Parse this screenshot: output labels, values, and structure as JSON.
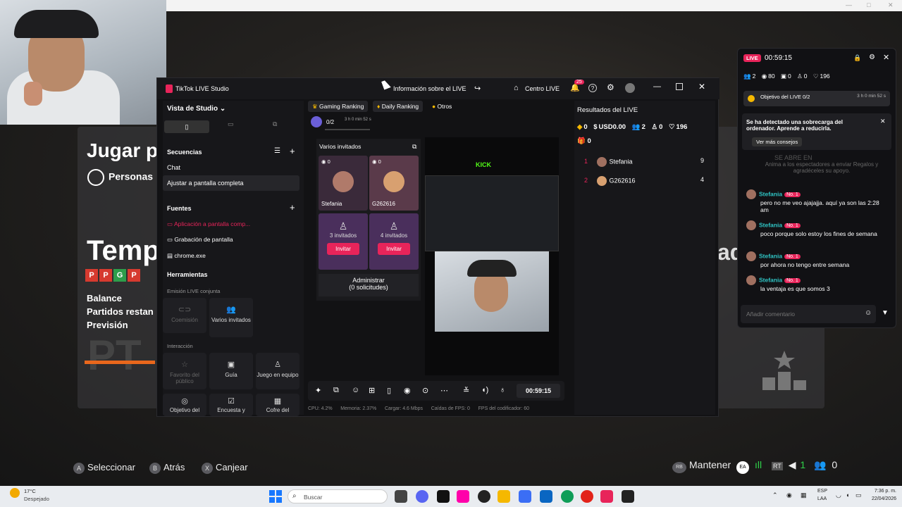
{
  "background": {
    "topstrip_controls": [
      "—",
      "□",
      "✕"
    ],
    "title_jugar": "Jugar p",
    "personas": "Personas",
    "title_temp": "Temp",
    "title_ores": "adores",
    "ppgp": [
      "P",
      "P",
      "G",
      "P"
    ],
    "lines": [
      "Balance",
      "Partidos restan",
      "Previsión"
    ],
    "pt": "PT",
    "hints": [
      {
        "key": "A",
        "label": "Seleccionar"
      },
      {
        "key": "B",
        "label": "Atrás"
      },
      {
        "key": "X",
        "label": "Canjear"
      }
    ],
    "right_hint": {
      "key": "RB",
      "label": "Mantener",
      "counts": [
        "1",
        "0"
      ]
    }
  },
  "studio": {
    "app_title": "TikTok LIVE Studio",
    "info_title": "Información sobre el LIVE",
    "centro": "Centro LIVE",
    "notif_count": "25",
    "view_mode": "Vista de Studio",
    "sequences": "Secuencias",
    "seq_items": [
      "Chat",
      "Ajustar a pantalla completa"
    ],
    "sources": "Fuentes",
    "source_items": [
      "Aplicación a pantalla comp...",
      "Grabación de pantalla",
      "chrome.exe"
    ],
    "tools": "Herramientas",
    "joint": "Emisión LIVE conjunta",
    "joint_tools": [
      "Coemisión",
      "Varios invitados"
    ],
    "interaction": "Interacción",
    "interaction_tools": [
      "Favorito del público",
      "Guía",
      "Juego en equipo"
    ],
    "bottom_tools": [
      "Objetivo del",
      "Encuesta y",
      "Cofre del"
    ],
    "rank_tabs": [
      "Gaming Ranking",
      "Daily Ranking",
      "Otros"
    ],
    "goal": "0/2",
    "goal_time": "3 h 0 min 52 s",
    "multi_guests": "Varios invitados",
    "guests": [
      {
        "name": "Stefania",
        "count": "0"
      },
      {
        "name": "G262616",
        "count": "0"
      }
    ],
    "slots": [
      {
        "label": "3 invitados",
        "btn": "Invitar"
      },
      {
        "label": "4 invitados",
        "btn": "Invitar"
      }
    ],
    "admin": "Administrar",
    "admin_sub": "(0 solicitudes)",
    "preview_logo": "KICK",
    "timer": "00:59:15",
    "stats": [
      "CPU: 4.2%",
      "Memoria: 2.37%",
      "Cargar: 4.6 Mbps",
      "Caídas de FPS: 0",
      "FPS del codificador: 60"
    ],
    "results_title": "Resultados del LIVE",
    "results_stats": [
      "0",
      "USD0.00",
      "2",
      "0",
      "196",
      "0"
    ],
    "ranking": [
      {
        "pos": "1",
        "name": "Stefania",
        "value": "9"
      },
      {
        "pos": "2",
        "name": "G262616",
        "value": "4"
      }
    ]
  },
  "chat": {
    "live_badge": "LIVE",
    "time": "00:59:15",
    "stats": [
      "2",
      "80",
      "0",
      "0",
      "196"
    ],
    "goal": "Objetivo del LIVE 0/2",
    "goal_time": "3 h 0 min 52 s",
    "alert": "Se ha detectado una sobrecarga del ordenador. Aprende a reducirla.",
    "alert_btn": "Ver más consejos",
    "ghost1": "SE ABRE EN",
    "ghost2": "Anima a los espectadores a enviar Regalos y agradéceles su apoyo.",
    "messages": [
      {
        "name": "Stefania",
        "badge": "No. 1",
        "text": "pero no me veo ajajajja. aquí ya son las 2:28 am"
      },
      {
        "name": "Stefania",
        "badge": "No. 1",
        "text": "poco porque solo estoy los fines de semana"
      },
      {
        "name": "Stefania",
        "badge": "No. 1",
        "text": "por ahora no tengo entre semana"
      },
      {
        "name": "Stefania",
        "badge": "No. 1",
        "text": "la ventaja es que somos 3"
      }
    ],
    "placeholder": "Añadir comentario"
  },
  "taskbar": {
    "weather_temp": "17°C",
    "weather_desc": "Despejado",
    "search": "Buscar",
    "lang1": "ESP",
    "lang2": "LAA",
    "time": "7:36 p. m.",
    "date": "22/04/2026",
    "colors": [
      "#1677ff",
      "#222",
      "#5865f2",
      "#111",
      "#f0a",
      "#f5b800",
      "#3b6ef5",
      "#0a66c2",
      "#0f9d58",
      "#e2231a",
      "#e8245a",
      "#222"
    ]
  }
}
